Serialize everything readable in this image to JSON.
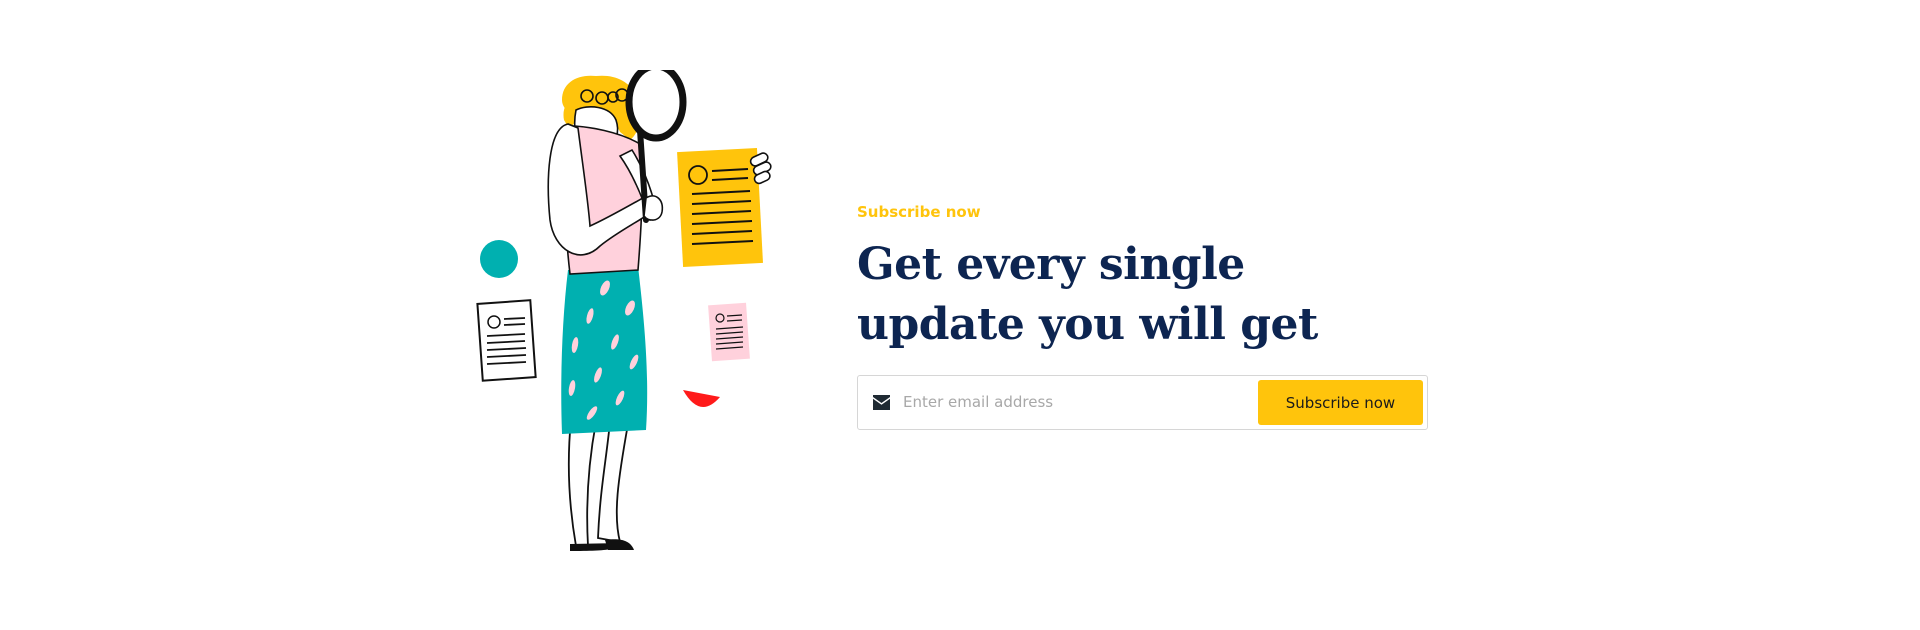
{
  "newsletter": {
    "eyebrow": "Subscribe now",
    "headline": "Get every single update you will get",
    "email_placeholder": "Enter email address",
    "email_value": "",
    "submit_label": "Subscribe now"
  },
  "icons": {
    "input_icon": "envelope-icon"
  },
  "colors": {
    "accent": "#ffc40c",
    "heading": "#0d2551",
    "teal": "#00b0b0",
    "pink": "#ffd1dc",
    "red": "#ff1a1a"
  }
}
